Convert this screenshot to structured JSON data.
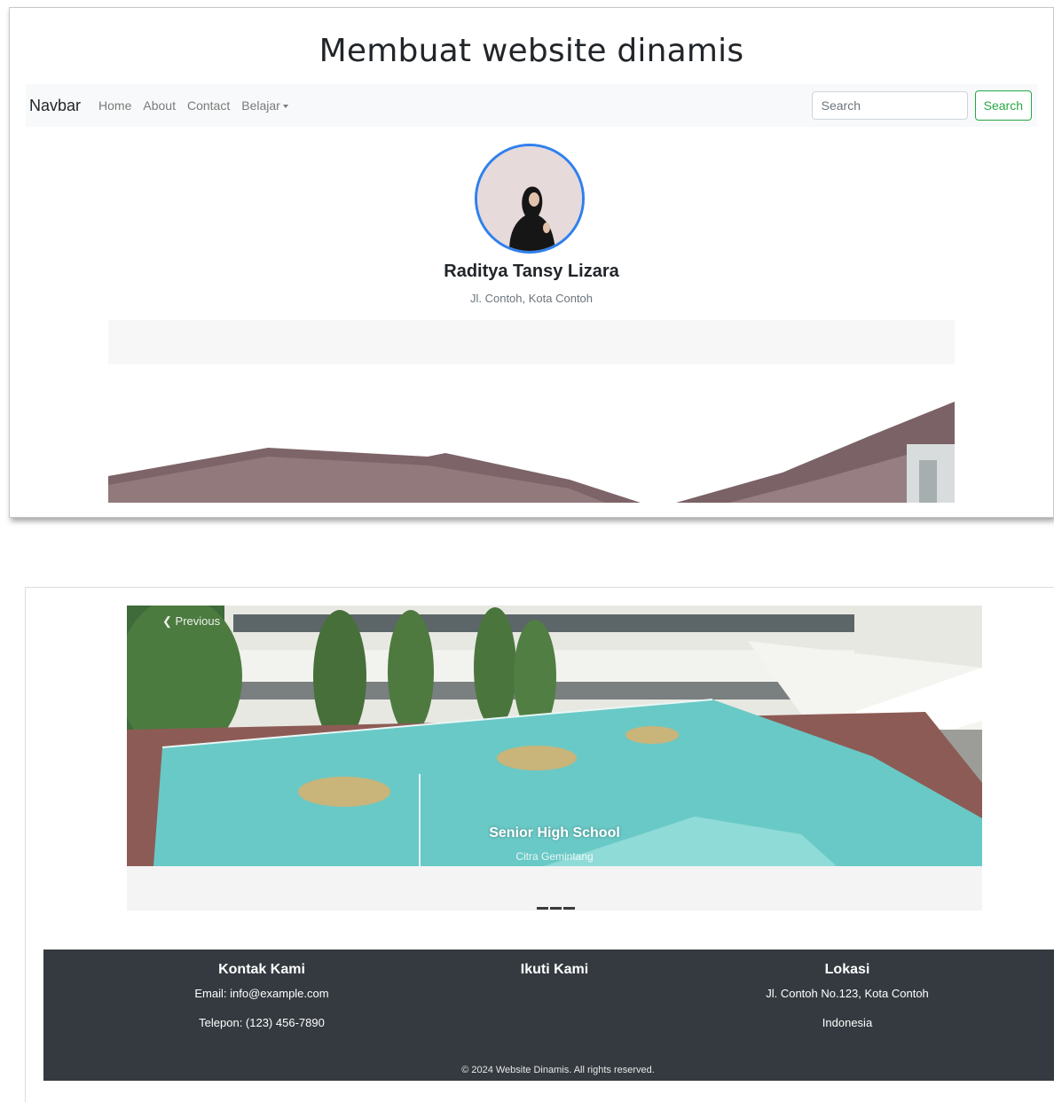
{
  "header": {
    "title": "Membuat website dinamis"
  },
  "navbar": {
    "brand": "Navbar",
    "links": [
      "Home",
      "About",
      "Contact"
    ],
    "dropdown_label": "Belajar",
    "search_placeholder": "Search",
    "search_button": "Search"
  },
  "profile": {
    "name": "Raditya Tansy Lizara",
    "address": "Jl. Contoh, Kota Contoh"
  },
  "carousel": {
    "prev_label": "Previous",
    "caption_title": "Senior High School",
    "caption_subtitle": "Citra Gemintang"
  },
  "footer": {
    "contact": {
      "heading": "Kontak Kami",
      "email": "Email: info@example.com",
      "phone": "Telepon: (123) 456-7890"
    },
    "follow": {
      "heading": "Ikuti Kami"
    },
    "location": {
      "heading": "Lokasi",
      "line1": "Jl. Contoh No.123, Kota Contoh",
      "line2": "Indonesia"
    },
    "copyright": "© 2024 Website Dinamis. All rights reserved."
  },
  "colors": {
    "navbar_bg": "#f8f9fa",
    "search_button_green": "#28a745",
    "avatar_border": "#2f80ed",
    "footer_bg": "#343a40"
  }
}
